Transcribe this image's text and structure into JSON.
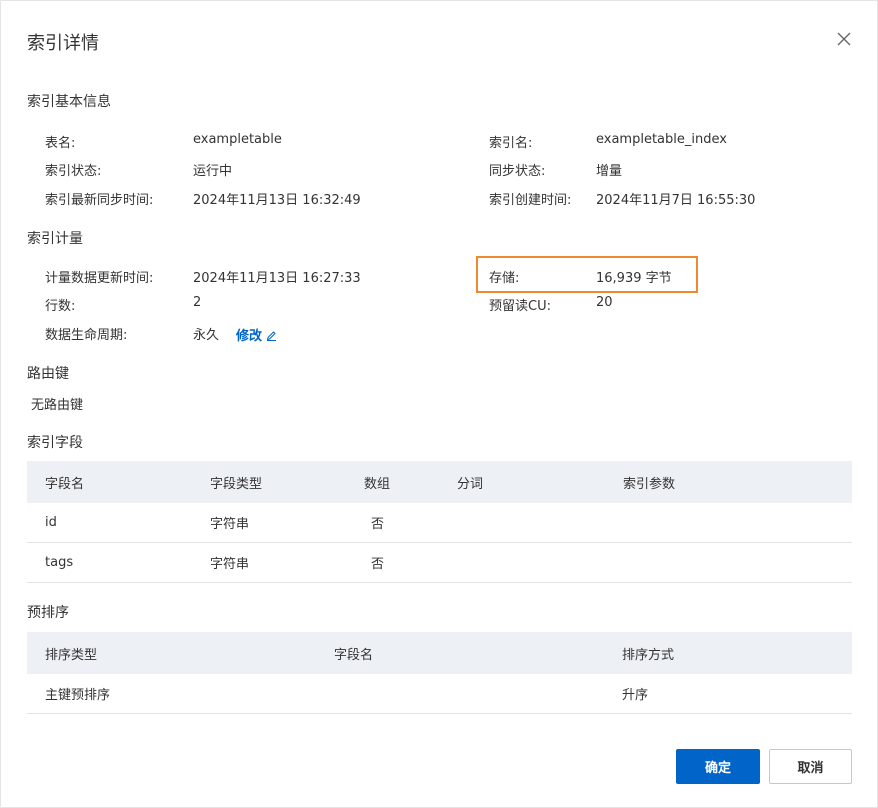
{
  "dialog": {
    "title": "索引详情",
    "close_icon": "close-icon"
  },
  "basic_info": {
    "title": "索引基本信息",
    "table_name_label": "表名:",
    "table_name_value": "exampletable",
    "index_name_label": "索引名:",
    "index_name_value": "exampletable_index",
    "index_status_label": "索引状态:",
    "index_status_value": "运行中",
    "sync_status_label": "同步状态:",
    "sync_status_value": "增量",
    "last_sync_label": "索引最新同步时间:",
    "last_sync_value": "2024年11月13日 16:32:49",
    "created_label": "索引创建时间:",
    "created_value": "2024年11月7日 16:55:30"
  },
  "metering": {
    "title": "索引计量",
    "update_time_label": "计量数据更新时间:",
    "update_time_value": "2024年11月13日 16:27:33",
    "storage_label": "存储:",
    "storage_value": "16,939 字节",
    "rows_label": "行数:",
    "rows_value": "2",
    "reserved_cu_label": "预留读CU:",
    "reserved_cu_value": "20",
    "ttl_label": "数据生命周期:",
    "ttl_value": "永久",
    "edit_link": "修改",
    "highlight_color": "#ee8a2e"
  },
  "routing": {
    "title": "路由键",
    "value": "无路由键"
  },
  "fields": {
    "title": "索引字段",
    "headers": [
      "字段名",
      "字段类型",
      "数组",
      "分词",
      "索引参数"
    ],
    "rows": [
      {
        "name": "id",
        "type": "字符串",
        "array": "否",
        "tokenize": "",
        "params": ""
      },
      {
        "name": "tags",
        "type": "字符串",
        "array": "否",
        "tokenize": "",
        "params": ""
      }
    ]
  },
  "presort": {
    "title": "预排序",
    "headers": [
      "排序类型",
      "字段名",
      "排序方式"
    ],
    "rows": [
      {
        "sort_type": "主键预排序",
        "field": "",
        "order": "升序"
      }
    ]
  },
  "footer": {
    "confirm": "确定",
    "cancel": "取消"
  },
  "colors": {
    "primary": "#0064c8",
    "table_header_bg": "#edf0f5"
  }
}
